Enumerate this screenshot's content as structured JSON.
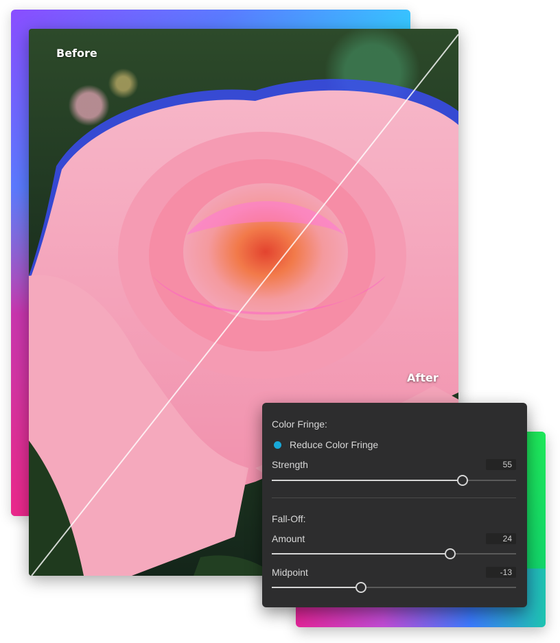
{
  "compare": {
    "before_label": "Before",
    "after_label": "After"
  },
  "panel": {
    "color_fringe_title": "Color Fringe:",
    "reduce_label": "Reduce Color Fringe",
    "strength": {
      "label": "Strength",
      "value": "55",
      "fraction": 0.78
    },
    "falloff_title": "Fall-Off:",
    "amount": {
      "label": "Amount",
      "value": "24",
      "fraction": 0.73
    },
    "midpoint": {
      "label": "Midpoint",
      "value": "-13",
      "fraction": 0.365
    }
  },
  "colors": {
    "accent": "#18a8d8",
    "panel_bg": "#2d2d2e"
  },
  "icons": {
    "radio": "radio-selected-icon"
  }
}
